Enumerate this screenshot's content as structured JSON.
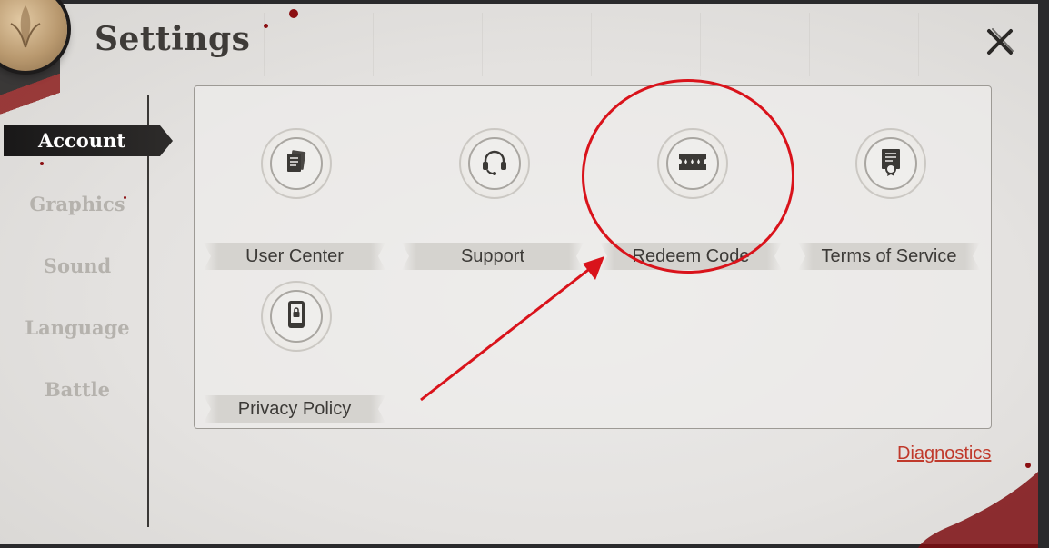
{
  "window": {
    "title": "Settings"
  },
  "sidebar": {
    "items": [
      {
        "label": "Account",
        "active": true
      },
      {
        "label": "Graphics",
        "active": false
      },
      {
        "label": "Sound",
        "active": false
      },
      {
        "label": "Language",
        "active": false
      },
      {
        "label": "Battle",
        "active": false
      }
    ]
  },
  "account": {
    "tiles": [
      {
        "label": "User Center",
        "icon": "documents-icon"
      },
      {
        "label": "Support",
        "icon": "headset-icon"
      },
      {
        "label": "Redeem Code",
        "icon": "ticket-icon"
      },
      {
        "label": "Terms of Service",
        "icon": "certificate-icon"
      },
      {
        "label": "Privacy Policy",
        "icon": "phone-lock-icon"
      }
    ]
  },
  "footer": {
    "diagnostics_label": "Diagnostics"
  },
  "colors": {
    "accent_red": "#d9131b",
    "link_red": "#c0392b",
    "active_tab_bg": "#1e1c1b",
    "panel_bg": "#e8e6e3"
  }
}
